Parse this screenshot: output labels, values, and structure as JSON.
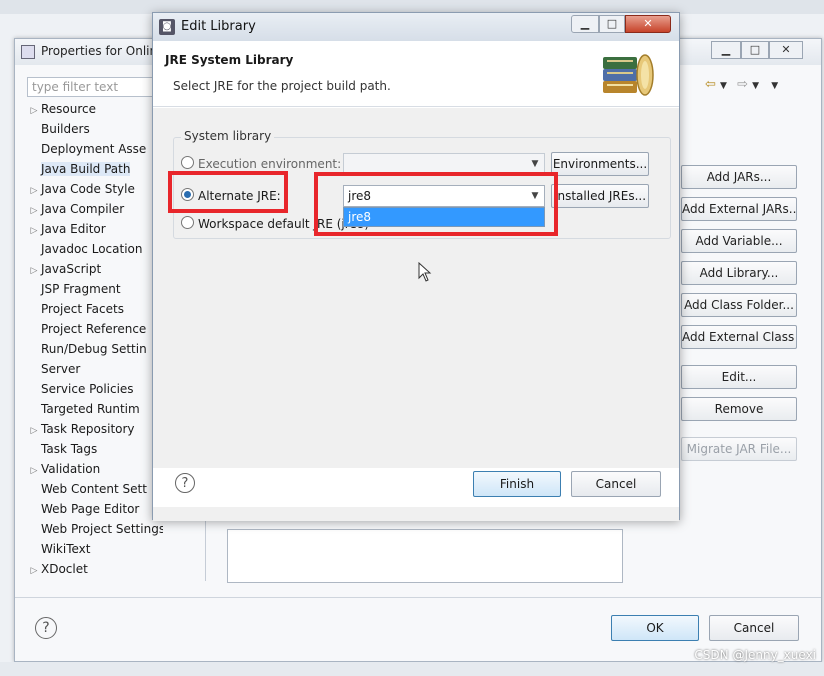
{
  "properties_window": {
    "title": "Properties for Onlin",
    "filter_placeholder": "type filter text",
    "tree_items": [
      {
        "label": "Resource",
        "expandable": true,
        "selected": false
      },
      {
        "label": "Builders",
        "expandable": false,
        "selected": false
      },
      {
        "label": "Deployment Asse",
        "expandable": false,
        "selected": false
      },
      {
        "label": "Java Build Path",
        "expandable": false,
        "selected": true
      },
      {
        "label": "Java Code Style",
        "expandable": true,
        "selected": false
      },
      {
        "label": "Java Compiler",
        "expandable": true,
        "selected": false
      },
      {
        "label": "Java Editor",
        "expandable": true,
        "selected": false
      },
      {
        "label": "Javadoc Location",
        "expandable": false,
        "selected": false
      },
      {
        "label": "JavaScript",
        "expandable": true,
        "selected": false
      },
      {
        "label": "JSP Fragment",
        "expandable": false,
        "selected": false
      },
      {
        "label": "Project Facets",
        "expandable": false,
        "selected": false
      },
      {
        "label": "Project Reference",
        "expandable": false,
        "selected": false
      },
      {
        "label": "Run/Debug Settin",
        "expandable": false,
        "selected": false
      },
      {
        "label": "Server",
        "expandable": false,
        "selected": false
      },
      {
        "label": "Service Policies",
        "expandable": false,
        "selected": false
      },
      {
        "label": "Targeted Runtim",
        "expandable": false,
        "selected": false
      },
      {
        "label": "Task Repository",
        "expandable": true,
        "selected": false
      },
      {
        "label": "Task Tags",
        "expandable": false,
        "selected": false
      },
      {
        "label": "Validation",
        "expandable": true,
        "selected": false
      },
      {
        "label": "Web Content Sett",
        "expandable": false,
        "selected": false
      },
      {
        "label": "Web Page Editor",
        "expandable": false,
        "selected": false
      },
      {
        "label": "Web Project Settings",
        "expandable": false,
        "selected": false
      },
      {
        "label": "WikiText",
        "expandable": false,
        "selected": false
      },
      {
        "label": "XDoclet",
        "expandable": true,
        "selected": false
      }
    ],
    "side_buttons": [
      {
        "label": "Add JARs...",
        "enabled": true
      },
      {
        "label": "Add External JARs...",
        "enabled": true
      },
      {
        "label": "Add Variable...",
        "enabled": true
      },
      {
        "label": "Add Library...",
        "enabled": true
      },
      {
        "label": "Add Class Folder...",
        "enabled": true
      },
      {
        "label": "Add External Class Folder...",
        "enabled": true
      },
      {
        "label": "Edit...",
        "enabled": true
      },
      {
        "label": "Remove",
        "enabled": true
      },
      {
        "label": "Migrate JAR File...",
        "enabled": false
      }
    ],
    "ok_label": "OK",
    "cancel_label": "Cancel",
    "help_label": "?"
  },
  "dialog": {
    "title": "Edit Library",
    "heading": "JRE System Library",
    "description": "Select JRE for the project build path.",
    "group_label": "System library",
    "options": {
      "execution_env": {
        "label": "Execution environment:",
        "checked": false
      },
      "alternate_jre": {
        "label": "Alternate JRE:",
        "checked": true
      },
      "workspace_default": {
        "label": "Workspace default JRE (jre8)",
        "checked": false
      }
    },
    "exec_combo_value": "",
    "alt_combo_value": "jre8",
    "dropdown_options": [
      "jre8"
    ],
    "environments_button": "Environments...",
    "installed_jres_button": "Installed JREs...",
    "finish_label": "Finish",
    "cancel_label": "Cancel",
    "help_label": "?"
  },
  "watermark": "CSDN @Jenny_xuexi",
  "colors": {
    "highlight": "#e8262b",
    "selection": "#3399ff",
    "ok_border": "#3c7fb1"
  }
}
